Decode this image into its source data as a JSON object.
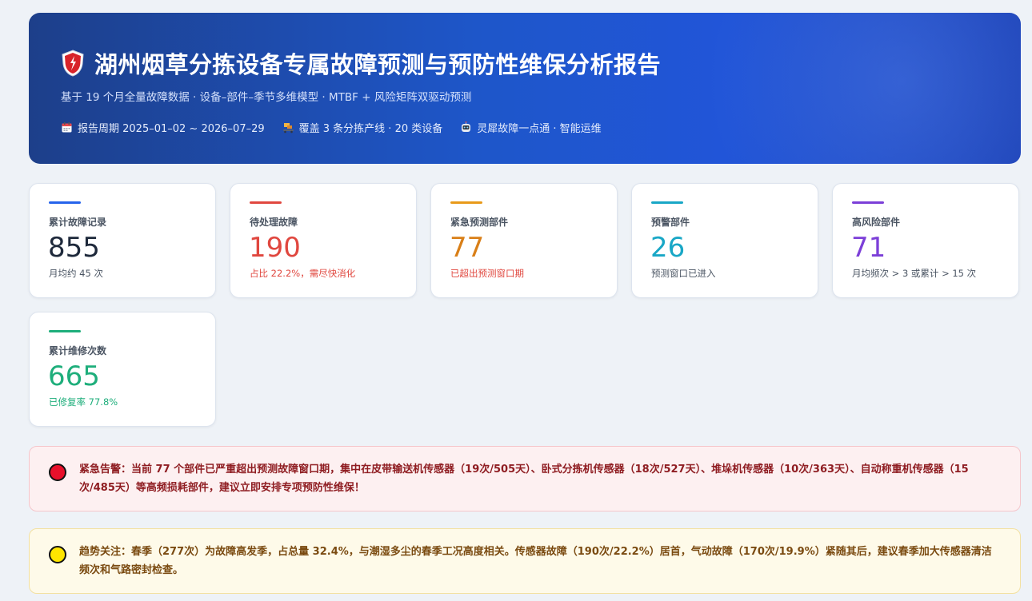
{
  "header": {
    "title": "湖州烟草分拣设备专属故障预测与预防性维保分析报告",
    "subtitle": "基于 19 个月全量故障数据 · 设备–部件–季节多维模型 · MTBF + 风险矩阵双驱动预测",
    "meta": [
      {
        "icon": "calendar-icon",
        "text": "报告周期 2025–01–02 ~ 2026–07–29"
      },
      {
        "icon": "conveyor-icon",
        "text": "覆盖 3 条分拣产线 · 20 类设备"
      },
      {
        "icon": "robot-icon",
        "text": "灵犀故障一点通 · 智能运维"
      }
    ]
  },
  "stats": [
    {
      "label": "累计故障记录",
      "value": "855",
      "note": "月均约 45 次",
      "color": "#1e293b",
      "bar_color": "#2563eb",
      "note_color": "#4b5563"
    },
    {
      "label": "待处理故障",
      "value": "190",
      "note": "占比 22.2%，需尽快消化",
      "color": "#e0473f",
      "bar_color": "#e0473f",
      "note_color": "#e0473f"
    },
    {
      "label": "紧急预测部件",
      "value": "77",
      "note": "已超出预测窗口期",
      "color": "#d97f18",
      "bar_color": "#e89a1a",
      "note_color": "#e0473f"
    },
    {
      "label": "预警部件",
      "value": "26",
      "note": "预测窗口已进入",
      "color": "#19a7c6",
      "bar_color": "#19a7c6",
      "note_color": "#4b5563"
    },
    {
      "label": "高风险部件",
      "value": "71",
      "note": "月均频次 > 3 或累计 > 15 次",
      "color": "#7c3fd8",
      "bar_color": "#7c3fd8",
      "note_color": "#4b5563"
    },
    {
      "label": "累计维修次数",
      "value": "665",
      "note": "已修复率 77.8%",
      "color": "#1eae7b",
      "bar_color": "#1eae7b",
      "note_color": "#1eae7b"
    }
  ],
  "alerts": {
    "urgent": {
      "text": "紧急告警：当前 77 个部件已严重超出预测故障窗口期，集中在皮带输送机传感器（19次/505天）、卧式分拣机传感器（18次/527天）、堆垛机传感器（10次/363天）、自动称重机传感器（15次/485天）等高频损耗部件，建议立即安排专项预防性维保！",
      "color": "#e8102b"
    },
    "trend": {
      "text": "趋势关注：春季（277次）为故障高发季，占总量 32.4%，与潮湿多尘的春季工况高度相关。传感器故障（190次/22.2%）居首，气动故障（170次/19.9%）紧随其后，建议春季加大传感器清洁频次和气路密封检查。",
      "color": "#ffe500"
    }
  }
}
